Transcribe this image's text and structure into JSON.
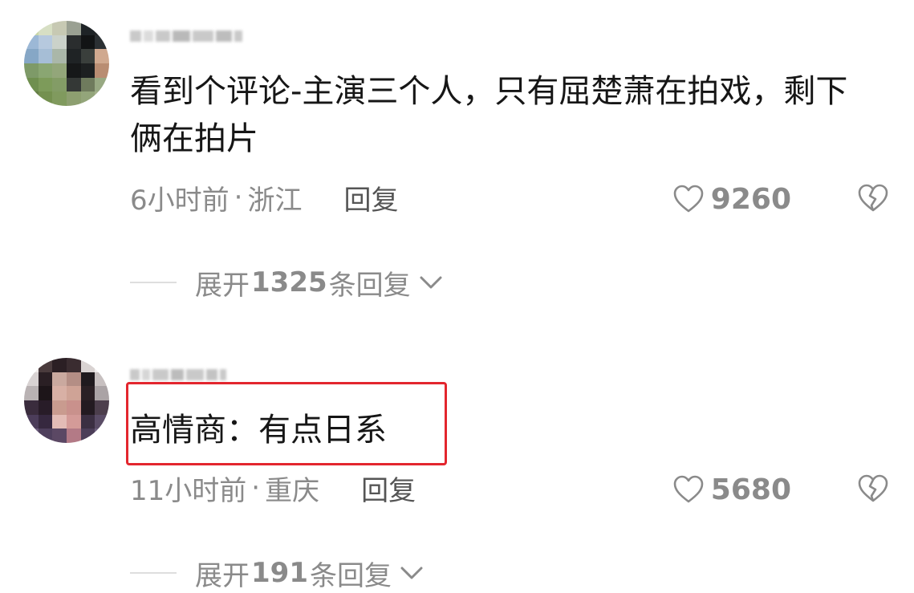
{
  "comments": [
    {
      "text": "看到个评论-主演三个人，只有屈楚萧在拍戏，剩下俩在拍片",
      "time": "6小时前",
      "separator": "·",
      "location": "浙江",
      "reply_label": "回复",
      "likes": "9260",
      "expand": {
        "prefix": "展开",
        "count": "1325",
        "suffix": "条回复"
      }
    },
    {
      "text": "高情商：有点日系",
      "time": "11小时前",
      "separator": "·",
      "location": "重庆",
      "reply_label": "回复",
      "likes": "5680",
      "expand": {
        "prefix": "展开",
        "count": "191",
        "suffix": "条回复"
      }
    }
  ],
  "icons": {
    "like": "heart-outline-icon",
    "dislike": "broken-heart-icon",
    "expand": "chevron-down-icon"
  },
  "colors": {
    "text": "#161616",
    "meta": "#8a8a8a",
    "highlight": "#e3262e"
  }
}
